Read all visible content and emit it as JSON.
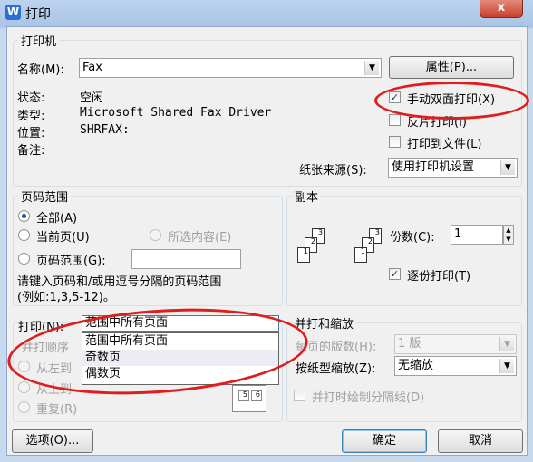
{
  "window": {
    "title": "打印",
    "app_logo": "W",
    "close_glyph": "x"
  },
  "printer": {
    "group_label": "打印机",
    "name_label": "名称(M):",
    "name_value": "Fax",
    "properties_button": "属性(P)...",
    "status_label": "状态:",
    "status_value": "空闲",
    "type_label": "类型:",
    "type_value": "Microsoft Shared Fax Driver",
    "location_label": "位置:",
    "location_value": "SHRFAX:",
    "comment_label": "备注:",
    "comment_value": "",
    "manual_duplex": {
      "label": "手动双面打印(X)",
      "checked": true
    },
    "reverse_print": {
      "label": "反片打印(I)",
      "checked": false
    },
    "print_to_file": {
      "label": "打印到文件(L)",
      "checked": false
    },
    "paper_source_label": "纸张来源(S):",
    "paper_source_value": "使用打印机设置"
  },
  "page_range": {
    "group_label": "页码范围",
    "all": "全部(A)",
    "current": "当前页(U)",
    "selection": "所选内容(E)",
    "pages": "页码范围(G):",
    "pages_value": "",
    "hint_line1": "请键入页码和/或用逗号分隔的页码范围",
    "hint_line2": "(例如:1,3,5-12)。"
  },
  "copies": {
    "group_label": "副本",
    "count_label": "份数(C):",
    "count_value": "1",
    "collate": {
      "label": "逐份打印(T)",
      "checked": true
    }
  },
  "print_what": {
    "label": "打印(N):",
    "value": "范围中所有页面",
    "options": [
      "范围中所有页面",
      "奇数页",
      "偶数页"
    ],
    "order_label": "并打顺序",
    "order_left_to_right": "从左到",
    "order_top_to_bottom": "从上到",
    "order_repeat": "重复(R)"
  },
  "zoom": {
    "group_label": "并打和缩放",
    "pages_per_sheet_label": "每页的版数(H):",
    "pages_per_sheet_value": "1 版",
    "scale_label": "按纸型缩放(Z):",
    "scale_value": "无缩放",
    "draw_borders": {
      "label": "并打时绘制分隔线(D)",
      "checked": false
    }
  },
  "footer": {
    "options_button": "选项(O)...",
    "ok_button": "确定",
    "cancel_button": "取消"
  },
  "annotation_color": "#e01d1d"
}
